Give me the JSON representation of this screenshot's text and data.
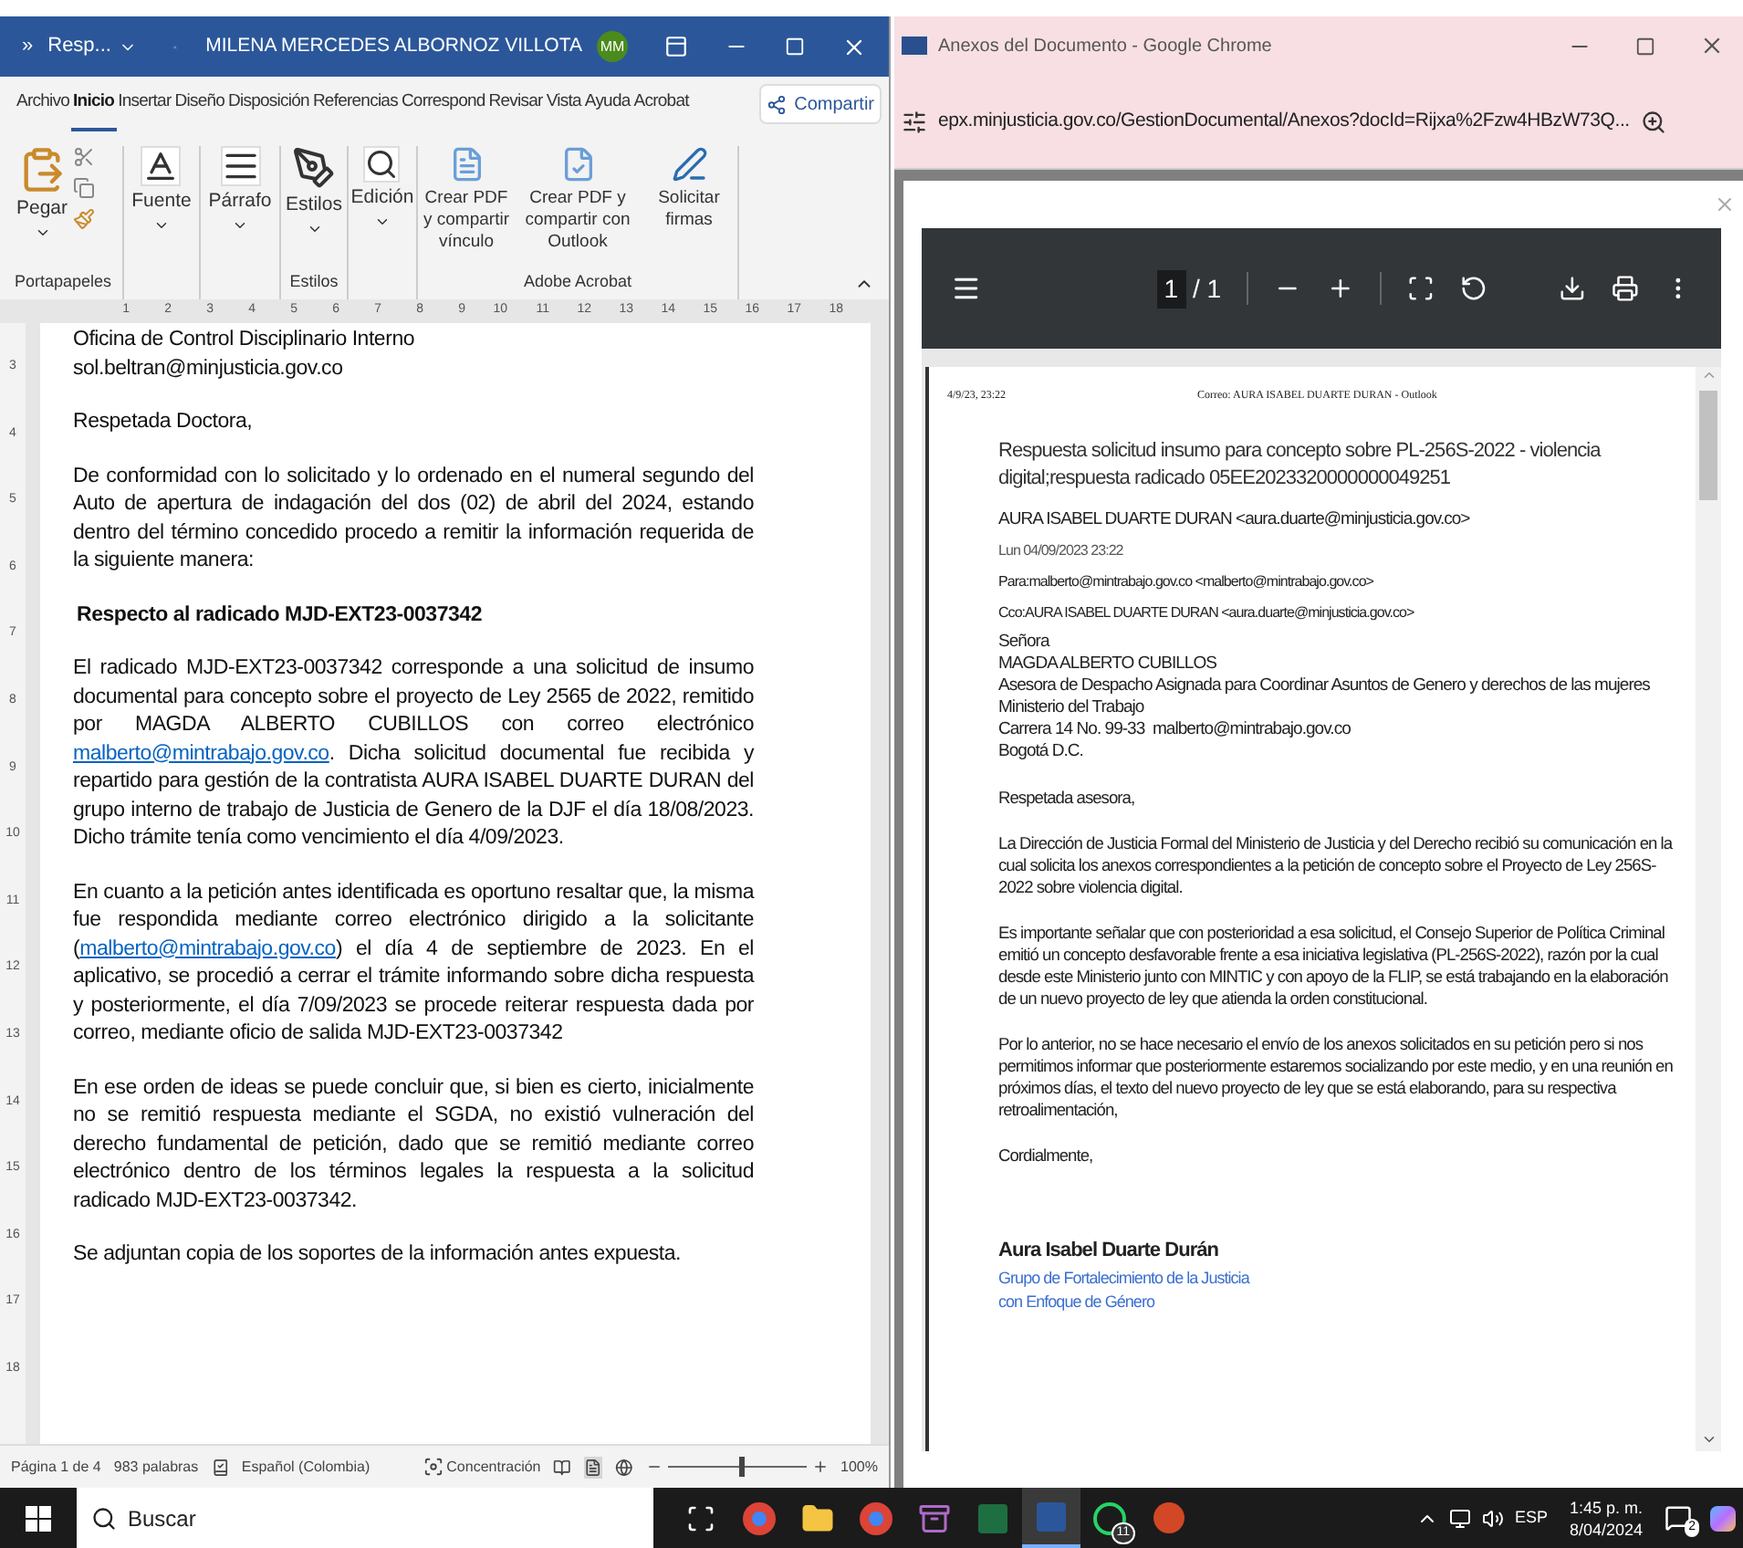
{
  "word": {
    "title_bar": {
      "overflow": "»",
      "doc_title": "Resp...",
      "user": "MILENA MERCEDES ALBORNOZ VILLOTA",
      "avatar": "MM"
    },
    "tabs": [
      {
        "label": "Archivo",
        "selected": false
      },
      {
        "label": "Inicio",
        "selected": true
      },
      {
        "label": "Insertar",
        "selected": false
      },
      {
        "label": "Diseño",
        "selected": false
      },
      {
        "label": "Disposición",
        "selected": false
      },
      {
        "label": "Referencias",
        "selected": false
      },
      {
        "label": "Correspond",
        "selected": false
      },
      {
        "label": "Revisar",
        "selected": false
      },
      {
        "label": "Vista",
        "selected": false
      },
      {
        "label": "Ayuda",
        "selected": false
      },
      {
        "label": "Acrobat",
        "selected": false
      }
    ],
    "share": "Compartir",
    "ribbon": {
      "paste": "Pegar",
      "clipboard_group": "Portapapeles",
      "font": "Fuente",
      "paragraph": "Párrafo",
      "styles": "Estilos",
      "styles_group": "Estilos",
      "editing": "Edición",
      "acrobat_actions": [
        "Crear PDF y compartir vínculo",
        "Crear PDF y compartir con Outlook",
        "Solicitar firmas"
      ],
      "acrobat_group": "Adobe Acrobat"
    },
    "ruler_marks": [
      "1",
      "2",
      "3",
      "4",
      "5",
      "6",
      "7",
      "8",
      "9",
      "10",
      "11",
      "12",
      "13",
      "14",
      "15",
      "16",
      "17",
      "18"
    ],
    "vertical_ruler_marks": [
      "3",
      "4",
      "5",
      "6",
      "7",
      "8",
      "9",
      "10",
      "11",
      "12",
      "13",
      "14",
      "15",
      "16",
      "17",
      "18"
    ],
    "paragraphs": [
      {
        "kind": "line",
        "segments": [
          {
            "text": "Oficina de Control Disciplinario Interno"
          }
        ]
      },
      {
        "kind": "line",
        "segments": [
          {
            "text": "sol.beltran@minjusticia.gov.co"
          }
        ]
      },
      {
        "kind": "gap"
      },
      {
        "kind": "line",
        "segments": [
          {
            "text": "Respetada Doctora,"
          }
        ]
      },
      {
        "kind": "gap"
      },
      {
        "kind": "body",
        "segments": [
          {
            "text": "De conformidad con lo solicitado y lo ordenado en el numeral segundo del Auto de apertura de indagación del dos (02) de abril del 2024, estando dentro del término concedido procedo a remitir la información requerida de la siguiente manera:"
          }
        ]
      },
      {
        "kind": "gap"
      },
      {
        "kind": "heading",
        "segments": [
          {
            "text": "Respecto al radicado MJD-EXT23-0037342"
          }
        ]
      },
      {
        "kind": "gap"
      },
      {
        "kind": "body",
        "segments": [
          {
            "text": "El radicado MJD-EXT23-0037342 corresponde a una solicitud de insumo documental para concepto sobre el proyecto de Ley 2565 de 2022, remitido por MAGDA ALBERTO CUBILLOS con correo electrónico "
          },
          {
            "text": "malberto@mintrabajo.gov.co",
            "link": true
          },
          {
            "text": ". Dicha solicitud documental fue recibida y repartido para gestión de la contratista AURA ISABEL DUARTE DURAN del grupo interno de trabajo de Justicia de Genero de la DJF el día 18/08/2023. Dicho trámite tenía como vencimiento el día 4/09/2023."
          }
        ]
      },
      {
        "kind": "gap"
      },
      {
        "kind": "body",
        "segments": [
          {
            "text": "En cuanto a la petición antes identificada es oportuno resaltar que, la misma fue respondida mediante correo electrónico dirigido a la solicitante ("
          },
          {
            "text": "malberto@mintrabajo.gov.co",
            "link": true
          },
          {
            "text": ") el día 4 de septiembre de 2023. En el aplicativo, se procedió a cerrar el trámite informando sobre dicha respuesta y posteriormente, el día 7/09/2023 se procede reiterar respuesta dada por correo, mediante oficio de salida MJD-EXT23-0037342"
          }
        ]
      },
      {
        "kind": "gap"
      },
      {
        "kind": "body",
        "segments": [
          {
            "text": "En ese orden de ideas se puede concluir que, si bien es cierto, inicialmente no se remitió respuesta mediante el SGDA, no existió vulneración del derecho fundamental de petición, dado que se remitió mediante correo electrónico dentro de los términos legales la respuesta a la solicitud radicado MJD-EXT23-0037342."
          }
        ]
      },
      {
        "kind": "gap"
      },
      {
        "kind": "line",
        "segments": [
          {
            "text": "Se adjuntan copia de los soportes de la información antes expuesta."
          }
        ]
      }
    ],
    "status_bar": {
      "page": "Página 1 de 4",
      "words": "983 palabras",
      "language": "Español (Colombia)",
      "focus": "Concentración",
      "zoom": {
        "level": 0.55
      },
      "zoom_reading": "100%"
    }
  },
  "chrome": {
    "title": "Anexos del Documento - Google Chrome",
    "url": "epx.minjusticia.gov.co/GestionDocumental/Anexos?docId=Rijxa%2Fzw4HBzW73Q...",
    "pdf_toolbar": {
      "page": "1",
      "page_total": "/ 1"
    },
    "pdf_page": {
      "header_left": "4/9/23, 23:22",
      "header_center": "Correo: AURA ISABEL DUARTE DURAN - Outlook",
      "subject": "Respuesta solicitud insumo para concepto sobre PL-256S-2022 - violencia digital;respuesta radicado 05EE2023320000000049251",
      "from": "AURA ISABEL DUARTE DURAN <aura.duarte@minjusticia.gov.co>",
      "date": "Lun 04/09/2023 23:22",
      "to": "Para:malberto@mintrabajo.gov.co <malberto@mintrabajo.gov.co>",
      "cc": "Cco:AURA ISABEL DUARTE DURAN <aura.duarte@minjusticia.gov.co>",
      "address": [
        "Señora",
        "MAGDA ALBERTO CUBILLOS",
        "Asesora de Despacho Asignada para Coordinar Asuntos de Genero y derechos de las mujeres",
        "Ministerio del Trabajo",
        "Carrera 14 No. 99-33  malberto@mintrabajo.gov.co",
        "Bogotá D.C."
      ],
      "body": [
        "Respetada asesora,",
        "La Dirección de Justicia Formal del Ministerio de Justicia y del Derecho recibió su comunicación en la cual solicita los anexos correspondientes a la petición de concepto sobre el Proyecto de Ley 256S-2022 sobre violencia digital.",
        "Es importante señalar que con posterioridad a esa solicitud, el Consejo Superior de Política Criminal emitió un concepto desfavorable frente a esa iniciativa legislativa (PL-256S-2022), razón por la cual desde este Ministerio junto con MINTIC y con apoyo de la FLIP, se está trabajando en la elaboración de un nuevo proyecto de ley que atienda la orden constitucional.",
        "Por lo anterior, no se hace necesario el envío de los anexos solicitados en su petición pero si nos permitimos informar que posteriormente estaremos socializando por este medio, y en una reunión en próximos días, el texto del nuevo proyecto de ley que se está elaborando, para su respectiva retroalimentación,",
        "Cordialmente,"
      ],
      "signature_name": "Aura Isabel Duarte Durán",
      "signature_lines": [
        "Grupo de Fortalecimiento de la Justicia",
        "con Enfoque de Género"
      ]
    }
  },
  "taskbar": {
    "search": "Buscar",
    "apps": [
      {
        "kind": "taskview",
        "selected": false
      },
      {
        "kind": "chrome",
        "selected": false
      },
      {
        "kind": "explorer",
        "selected": false
      },
      {
        "kind": "chrome",
        "selected": false
      },
      {
        "kind": "archive",
        "selected": false
      },
      {
        "kind": "excel",
        "selected": false
      },
      {
        "kind": "word",
        "selected": true
      },
      {
        "kind": "whatsapp",
        "selected": false,
        "badge": "11"
      },
      {
        "kind": "powerpoint",
        "selected": false
      }
    ],
    "language": "ESP",
    "time": "1:45 p. m.",
    "date": "8/04/2024",
    "notifications": "2"
  }
}
